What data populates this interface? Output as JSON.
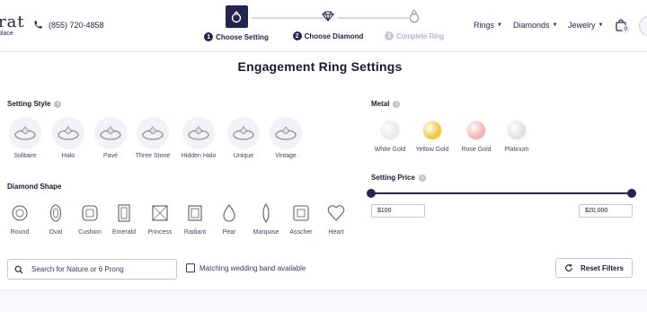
{
  "brand": {
    "logo_text": "rat",
    "tagline": "place"
  },
  "header": {
    "phone": "(855) 720-4858"
  },
  "steps": [
    {
      "num": "1",
      "label": "Choose Setting",
      "icon": "setting-ring-icon",
      "state": "active"
    },
    {
      "num": "2",
      "label": "Choose Diamond",
      "icon": "diamond-icon",
      "state": "active"
    },
    {
      "num": "3",
      "label": "Complete Ring",
      "icon": "complete-ring-icon",
      "state": "pending"
    }
  ],
  "nav": [
    {
      "label": "Rings"
    },
    {
      "label": "Diamonds"
    },
    {
      "label": "Jewelry"
    }
  ],
  "cart": {
    "count": "0"
  },
  "page_title": "Engagement Ring Settings",
  "setting_style": {
    "label": "Setting Style",
    "items": [
      "Solitaire",
      "Halo",
      "Pavé",
      "Three Stone",
      "Hidden Halo",
      "Unique",
      "Vintage"
    ]
  },
  "diamond_shape": {
    "label": "Diamond Shape",
    "items": [
      "Round",
      "Oval",
      "Cushion",
      "Emerald",
      "Princess",
      "Radiant",
      "Pear",
      "Marquise",
      "Asscher",
      "Heart"
    ]
  },
  "metal": {
    "label": "Metal",
    "items": [
      {
        "label": "White Gold",
        "color": "#e9e9ea"
      },
      {
        "label": "Yellow Gold",
        "color": "#f1c93b"
      },
      {
        "label": "Rose Gold",
        "color": "#f3b3b5"
      },
      {
        "label": "Platinum",
        "color": "#e2e2e4"
      }
    ]
  },
  "price": {
    "label": "Setting Price",
    "min": "$100",
    "max": "$20,000",
    "min_fraction": 0.0,
    "max_fraction": 1.0
  },
  "search": {
    "placeholder": "Search for Nature or 6 Prong"
  },
  "wedding_band": {
    "label": "Matching wedding band available",
    "checked": false
  },
  "reset": {
    "label": "Reset Filters"
  },
  "colors": {
    "navy": "#23264d",
    "track": "#23264d"
  }
}
